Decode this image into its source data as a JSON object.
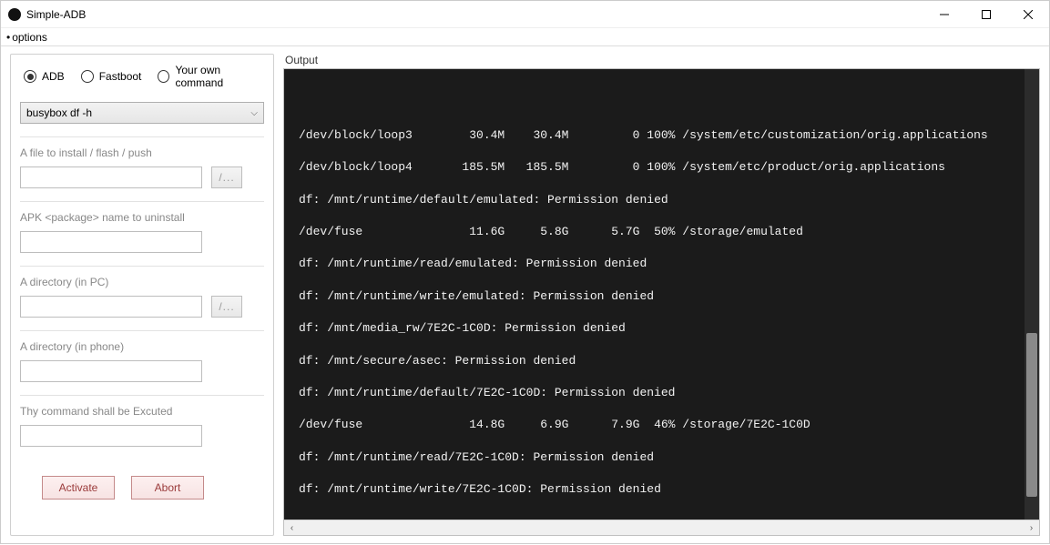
{
  "window": {
    "title": "Simple-ADB"
  },
  "menu": {
    "options": "options"
  },
  "mode": {
    "adb": "ADB",
    "fastboot": "Fastboot",
    "custom": "Your own command",
    "selected": "adb"
  },
  "command_select": {
    "value": "busybox df -h"
  },
  "group_install": {
    "label": "A file to install / flash / push",
    "value": "",
    "browse": "/..."
  },
  "group_uninstall": {
    "label": "APK <package> name to uninstall",
    "value": ""
  },
  "group_dir_pc": {
    "label": "A directory (in PC)",
    "value": "",
    "browse": "/..."
  },
  "group_dir_phone": {
    "label": "A directory (in phone)",
    "value": ""
  },
  "group_command": {
    "label": "Thy command shall be Excuted",
    "value": ""
  },
  "buttons": {
    "activate": "Activate",
    "abort": "Abort"
  },
  "output": {
    "label": "Output",
    "lines": [
      "/dev/block/loop3        30.4M    30.4M         0 100% /system/etc/customization/orig.applications",
      "/dev/block/loop4       185.5M   185.5M         0 100% /system/etc/product/orig.applications",
      "df: /mnt/runtime/default/emulated: Permission denied",
      "/dev/fuse               11.6G     5.8G      5.7G  50% /storage/emulated",
      "df: /mnt/runtime/read/emulated: Permission denied",
      "df: /mnt/runtime/write/emulated: Permission denied",
      "df: /mnt/media_rw/7E2C-1C0D: Permission denied",
      "df: /mnt/secure/asec: Permission denied",
      "df: /mnt/runtime/default/7E2C-1C0D: Permission denied",
      "/dev/fuse               14.8G     6.9G      7.9G  46% /storage/7E2C-1C0D",
      "df: /mnt/runtime/read/7E2C-1C0D: Permission denied",
      "df: /mnt/runtime/write/7E2C-1C0D: Permission denied"
    ]
  }
}
